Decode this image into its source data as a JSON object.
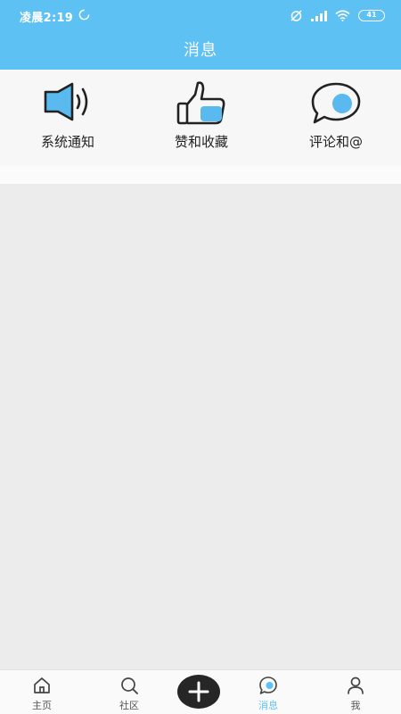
{
  "status_bar": {
    "time": "凌晨2:19",
    "battery": "41"
  },
  "header": {
    "title": "消息"
  },
  "entries": [
    {
      "label": "系统通知",
      "icon": "speaker-icon"
    },
    {
      "label": "赞和收藏",
      "icon": "thumbs-up-icon"
    },
    {
      "label": "评论和@",
      "icon": "chat-bubble-icon"
    }
  ],
  "tab_bar": {
    "tabs": [
      {
        "label": "主页",
        "icon": "home-icon"
      },
      {
        "label": "社区",
        "icon": "search-icon"
      },
      {
        "label": "消息",
        "icon": "message-icon",
        "active": true
      },
      {
        "label": "我",
        "icon": "person-icon"
      }
    ],
    "add_icon": "plus-icon"
  },
  "colors": {
    "accent": "#5ec1f3",
    "background": "#ececec",
    "icon_fill": "#5ab9ef",
    "add_button": "#262626"
  }
}
